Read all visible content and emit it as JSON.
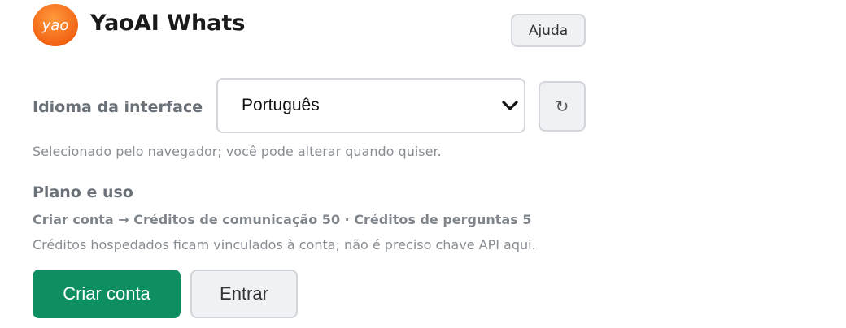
{
  "header": {
    "logo_text": "yao",
    "app_title": "YaoAI Whats",
    "help_label": "Ajuda"
  },
  "language": {
    "label": "Idioma da interface",
    "selected": "Português",
    "refresh_icon": "↻",
    "hint": "Selecionado pelo navegador; você pode alterar quando quiser."
  },
  "plan": {
    "title": "Plano e uso",
    "summary": "Criar conta → Créditos de comunicação 50 · Créditos de perguntas 5",
    "note": "Créditos hospedados ficam vinculados à conta; não é preciso chave API aqui."
  },
  "actions": {
    "create_label": "Criar conta",
    "login_label": "Entrar"
  },
  "colors": {
    "brand_orange": "#f26b12",
    "primary_green": "#0e8f62"
  }
}
